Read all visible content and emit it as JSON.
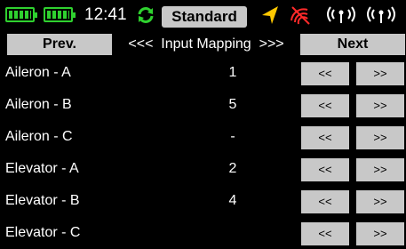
{
  "status": {
    "time": "12:41",
    "model_name": "Standard",
    "colors": {
      "battery": "#2fd12f",
      "sync": "#2fd12f",
      "gps": "#ffc800",
      "wifi": "#ff2a2a"
    },
    "icons": [
      "transmitter-battery-icon",
      "receiver-battery-icon",
      "sync-icon",
      "gps-icon",
      "wifi-off-icon",
      "receiver-signal-icon-1",
      "receiver-signal-icon-2"
    ]
  },
  "nav": {
    "prev_label": "Prev.",
    "title": "<<<  Input Mapping  >>>",
    "next_label": "Next"
  },
  "rows": [
    {
      "name": "Aileron - A",
      "value": "1",
      "dec_label": "<<",
      "inc_label": ">>"
    },
    {
      "name": "Aileron - B",
      "value": "5",
      "dec_label": "<<",
      "inc_label": ">>"
    },
    {
      "name": "Aileron - C",
      "value": "-",
      "dec_label": "<<",
      "inc_label": ">>"
    },
    {
      "name": "Elevator - A",
      "value": "2",
      "dec_label": "<<",
      "inc_label": ">>"
    },
    {
      "name": "Elevator - B",
      "value": "4",
      "dec_label": "<<",
      "inc_label": ">>"
    },
    {
      "name": "Elevator - C",
      "value": "",
      "dec_label": "<<",
      "inc_label": ">>"
    }
  ]
}
